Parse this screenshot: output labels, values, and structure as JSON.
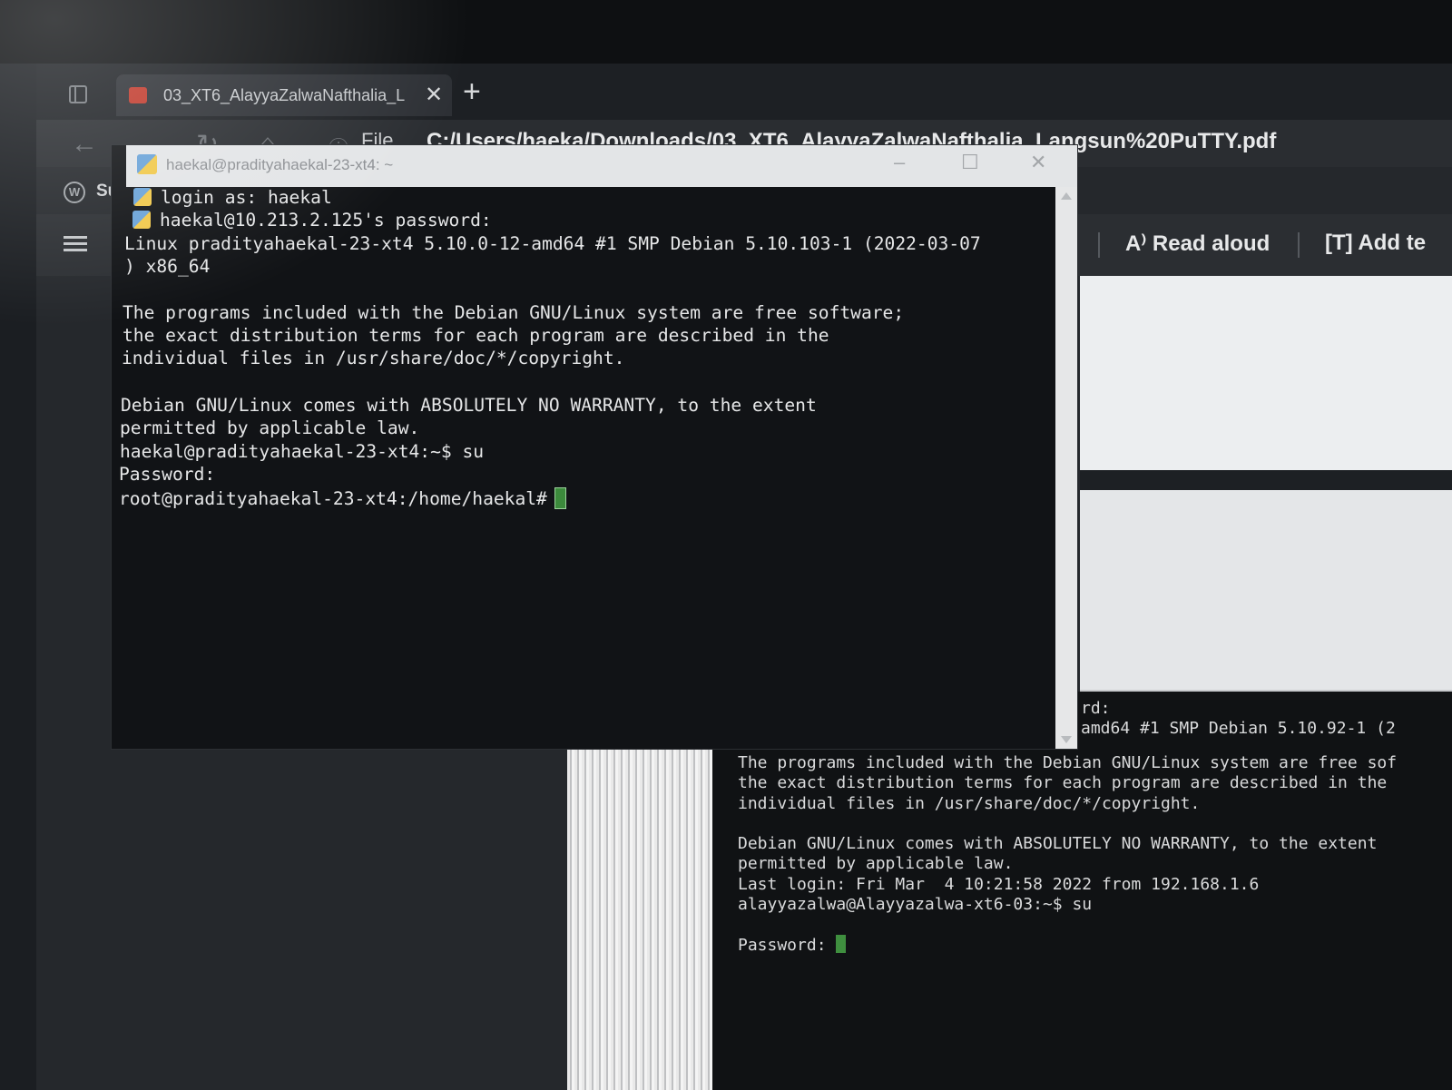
{
  "browser": {
    "tab_title": "03_XT6_AlayyaZalwaNafthalia_L",
    "tab_close": "✕",
    "new_tab": "+",
    "address_prefix": "File",
    "address": "C:/Users/haeka/Downloads/03_XT6_AlayyaZalwaNafthalia_Langsun%20PuTTY.pdf",
    "favorite_label": "Sun",
    "read_aloud": "Read aloud",
    "add_text": "Add te",
    "icons": [
      "sidebar-toggle-icon",
      "back-icon",
      "forward-icon",
      "refresh-icon",
      "home-icon",
      "info-icon",
      "wordpress-icon",
      "table-of-contents-icon",
      "read-aloud-icon",
      "add-text-icon"
    ]
  },
  "putty": {
    "title": "haekal@pradityahaekal-23-xt4: ~",
    "lines": [
      "login as: haekal",
      "haekal@10.213.2.125's password:",
      "Linux pradityahaekal-23-xt4 5.10.0-12-amd64 #1 SMP Debian 5.10.103-1 (2022-03-07",
      ") x86_64",
      "",
      "The programs included with the Debian GNU/Linux system are free software;",
      "the exact distribution terms for each program are described in the",
      "individual files in /usr/share/doc/*/copyright.",
      "",
      "Debian GNU/Linux comes with ABSOLUTELY NO WARRANTY, to the extent",
      "permitted by applicable law.",
      "haekal@pradityahaekal-23-xt4:~$ su",
      "Password:",
      "root@pradityahaekal-23-xt4:/home/haekal#"
    ]
  },
  "background_terminal": {
    "fragment_1": "rd:",
    "fragment_2": "amd64 #1 SMP Debian 5.10.92-1 (2",
    "body": "The programs included with the Debian GNU/Linux system are free sof\nthe exact distribution terms for each program are described in the\nindividual files in /usr/share/doc/*/copyright.\n\nDebian GNU/Linux comes with ABSOLUTELY NO WARRANTY, to the extent\npermitted by applicable law.\nLast login: Fri Mar  4 10:21:58 2022 from 192.168.1.6\nalayyazalwa@Alayyazalwa-xt6-03:~$ su",
    "prompt": "Password:"
  },
  "colors": {
    "cursor": "#3c8a3c",
    "terminal_bg": "#111316",
    "terminal_fg": "#e6e7e8"
  }
}
